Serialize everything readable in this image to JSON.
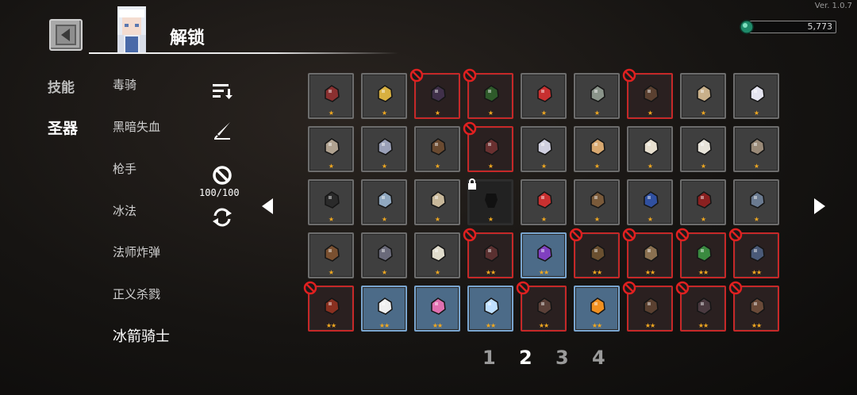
{
  "version": "Ver. 1.0.7",
  "header": {
    "title": "解锁"
  },
  "currency": {
    "amount": "5,773",
    "icon": "green-gem-icon"
  },
  "tabs": [
    {
      "label": "技能",
      "active": false
    },
    {
      "label": "圣器",
      "active": true
    }
  ],
  "heroes": [
    {
      "label": "毒骑",
      "active": false
    },
    {
      "label": "黑暗失血",
      "active": false
    },
    {
      "label": "枪手",
      "active": false
    },
    {
      "label": "冰法",
      "active": false
    },
    {
      "label": "法师炸弹",
      "active": false
    },
    {
      "label": "正义杀戮",
      "active": false
    },
    {
      "label": "冰箭骑士",
      "active": true
    }
  ],
  "tools": {
    "sort_icon": "sort-icon",
    "quill_icon": "quill-icon",
    "ban_icon": "ban-icon",
    "count": "100/100",
    "refresh_icon": "refresh-icon"
  },
  "pagination": {
    "pages": [
      "1",
      "2",
      "3",
      "4"
    ],
    "current": "2"
  },
  "grid": {
    "rows": [
      [
        {
          "item": "spider-claw",
          "color": "#8a3030",
          "stars": 1,
          "state": "normal"
        },
        {
          "item": "gold-coin",
          "color": "#d8b040",
          "stars": 1,
          "state": "normal"
        },
        {
          "item": "dark-pot",
          "color": "#40304a",
          "stars": 1,
          "state": "banned"
        },
        {
          "item": "herbs",
          "color": "#2e5a2a",
          "stars": 1,
          "state": "banned"
        },
        {
          "item": "ruby",
          "color": "#c83030",
          "stars": 1,
          "state": "normal"
        },
        {
          "item": "jar",
          "color": "#8a948a",
          "stars": 1,
          "state": "normal"
        },
        {
          "item": "fang",
          "color": "#5a4030",
          "stars": 1,
          "state": "banned"
        },
        {
          "item": "necklace",
          "color": "#c9b08a",
          "stars": 1,
          "state": "normal"
        },
        {
          "item": "pearl",
          "color": "#e4e4f0",
          "stars": 1,
          "state": "normal"
        }
      ],
      [
        {
          "item": "stone",
          "color": "#b0a290",
          "stars": 1,
          "state": "normal"
        },
        {
          "item": "crystal",
          "color": "#9aa0b8",
          "stars": 1,
          "state": "normal"
        },
        {
          "item": "book",
          "color": "#6a4a30",
          "stars": 1,
          "state": "normal"
        },
        {
          "item": "meat",
          "color": "#6a3030",
          "stars": 1,
          "state": "banned"
        },
        {
          "item": "claws",
          "color": "#d0d0e0",
          "stars": 1,
          "state": "normal"
        },
        {
          "item": "peanut",
          "color": "#d8a870",
          "stars": 1,
          "state": "normal"
        },
        {
          "item": "feather",
          "color": "#e8e0d0",
          "stars": 1,
          "state": "normal"
        },
        {
          "item": "fan",
          "color": "#e8e4da",
          "stars": 1,
          "state": "normal"
        },
        {
          "item": "gauntlet",
          "color": "#9a8a78",
          "stars": 1,
          "state": "normal"
        }
      ],
      [
        {
          "item": "pan",
          "color": "#2a2a2a",
          "stars": 1,
          "state": "normal"
        },
        {
          "item": "ring",
          "color": "#90a8c0",
          "stars": 1,
          "state": "normal"
        },
        {
          "item": "scroll",
          "color": "#c8b89a",
          "stars": 1,
          "state": "normal"
        },
        {
          "item": "locked",
          "color": "#333333",
          "stars": 1,
          "state": "locked"
        },
        {
          "item": "magnet",
          "color": "#c83030",
          "stars": 1,
          "state": "normal"
        },
        {
          "item": "wand",
          "color": "#7a5a3a",
          "stars": 1,
          "state": "normal"
        },
        {
          "item": "shield",
          "color": "#3050a0",
          "stars": 1,
          "state": "normal"
        },
        {
          "item": "heart",
          "color": "#8a2020",
          "stars": 1,
          "state": "normal"
        },
        {
          "item": "hook",
          "color": "#6a7a90",
          "stars": 1,
          "state": "normal"
        }
      ],
      [
        {
          "item": "seed",
          "color": "#7a5030",
          "stars": 1,
          "state": "normal"
        },
        {
          "item": "bomb",
          "color": "#6a6a7a",
          "stars": 1,
          "state": "normal"
        },
        {
          "item": "bone",
          "color": "#e0dccc",
          "stars": 1,
          "state": "normal"
        },
        {
          "item": "bat-wing",
          "color": "#5a3030",
          "stars": 2,
          "state": "banned"
        },
        {
          "item": "purple-horn",
          "color": "#8040c0",
          "stars": 2,
          "state": "selected"
        },
        {
          "item": "bottle",
          "color": "#6a5030",
          "stars": 2,
          "state": "banned"
        },
        {
          "item": "shell",
          "color": "#8a7050",
          "stars": 2,
          "state": "banned"
        },
        {
          "item": "green-tome",
          "color": "#3a8a40",
          "stars": 2,
          "state": "banned"
        },
        {
          "item": "armor",
          "color": "#4a5a78",
          "stars": 2,
          "state": "banned"
        }
      ],
      [
        {
          "item": "eye",
          "color": "#8a3020",
          "stars": 2,
          "state": "banned"
        },
        {
          "item": "dice",
          "color": "#f0f0f0",
          "stars": 2,
          "state": "selected"
        },
        {
          "item": "pink-card",
          "color": "#e070b0",
          "stars": 2,
          "state": "selected"
        },
        {
          "item": "ice-shard",
          "color": "#c0e0ff",
          "stars": 2,
          "state": "selected"
        },
        {
          "item": "bat",
          "color": "#5a4038",
          "stars": 2,
          "state": "banned"
        },
        {
          "item": "orange",
          "color": "#f09020",
          "stars": 2,
          "state": "selected"
        },
        {
          "item": "crossbow",
          "color": "#5a4030",
          "stars": 2,
          "state": "banned"
        },
        {
          "item": "dark-feather",
          "color": "#4a3a40",
          "stars": 2,
          "state": "banned"
        },
        {
          "item": "claw-hand",
          "color": "#6a4a38",
          "stars": 2,
          "state": "banned"
        }
      ]
    ]
  }
}
